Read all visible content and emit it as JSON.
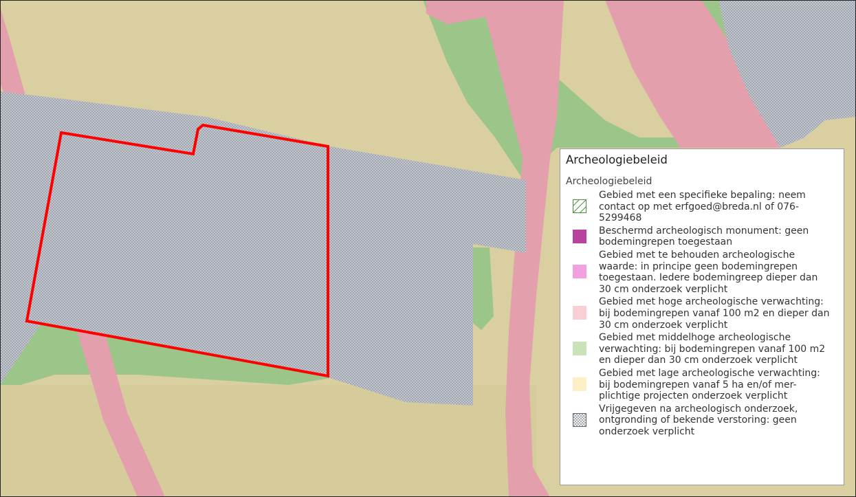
{
  "colors": {
    "base": "#d9cfa0",
    "pink": "#e3a0ac",
    "green": "#9cc58a",
    "monument": "#b7439f",
    "behouden": "#f2a0de",
    "hoog": "#f8cfd2",
    "middel": "#c9e2b8",
    "laag": "#fdf0c6",
    "hatch_green": "#4a8f3a",
    "vrij_dot": "#7a7f8a",
    "plot_outline": "#ff0000"
  },
  "legend": {
    "title": "Archeologiebeleid",
    "subtitle": "Archeologiebeleid",
    "items": [
      {
        "swatch": "hatch-green",
        "label": "Gebied met een specifieke bepaling: neem contact op met erfgoed@breda.nl of 076-5299468"
      },
      {
        "swatch": "monument",
        "label": "Beschermd archeologisch monument: geen bodemingrepen toegestaan"
      },
      {
        "swatch": "behouden",
        "label": "Gebied met te behouden archeologische waarde: in principe geen bodemingrepen toegestaan. Iedere bodemingreep dieper dan 30 cm onderzoek verplicht"
      },
      {
        "swatch": "hoog",
        "label": "Gebied met hoge archeologische verwachting: bij bodemingrepen vanaf 100 m2 en dieper dan 30 cm onderzoek verplicht"
      },
      {
        "swatch": "middel",
        "label": "Gebied met middelhoge archeologische verwachting: bij bodemingrepen vanaf 100 m2 en dieper dan 30 cm onderzoek verplicht"
      },
      {
        "swatch": "laag",
        "label": "Gebied met lage archeologische verwachting: bij bodemingrepen vanaf 5 ha en/of mer-plichtige projecten onderzoek verplicht"
      },
      {
        "swatch": "crosshatch",
        "label": "Vrijgegeven na archeologisch onderzoek, ontgronding of bekende verstoring: geen onderzoek verplicht"
      }
    ]
  }
}
